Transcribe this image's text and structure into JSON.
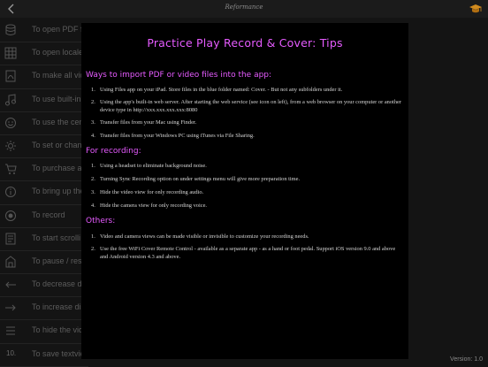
{
  "window": {
    "logo_text": "Reformance",
    "version": "Version: 1.0"
  },
  "icons": {
    "back": "back-arrow-icon",
    "top_right": "graduation-cap-icon"
  },
  "colors": {
    "accent": "#e65bff",
    "panel_bg": "#000000",
    "app_bg": "#141414"
  },
  "sidebar": {
    "items": [
      {
        "icon": "database-icon",
        "label": "To open PDF fil"
      },
      {
        "icon": "grid-icon",
        "label": "To open locale"
      },
      {
        "icon": "pdf-file-icon",
        "label": "To make all vid"
      },
      {
        "icon": "music-note-icon",
        "label": "To use built-in"
      },
      {
        "icon": "smiley-icon",
        "label": "To use the cent"
      },
      {
        "icon": "gear-icon",
        "label": "To set or chang"
      },
      {
        "icon": "cart-icon",
        "label": "To purchase an"
      },
      {
        "icon": "info-icon",
        "label": "To bring up the"
      },
      {
        "icon": "record-icon",
        "label": "To record"
      },
      {
        "icon": "document-icon",
        "label": "To start scrolli"
      },
      {
        "icon": "building-icon",
        "label": "To pause / rest"
      },
      {
        "icon": "left-arrow-icon",
        "label": "To decrease dis"
      },
      {
        "icon": "right-arrow-icon",
        "label": "To increase dis"
      },
      {
        "icon": "list-icon",
        "label": "To hide the vid"
      },
      {
        "icon": "number-icon",
        "label": "To save textvie",
        "num": "10."
      }
    ]
  },
  "panel": {
    "title": "Practice Play Record & Cover:  Tips",
    "sections": [
      {
        "heading": "Ways to import PDF or video files into the app:",
        "items": [
          {
            "n": "1.",
            "text": "Using Files app on your iPad.  Store files in the blue folder named:  Cover. - But not any subfolders under it."
          },
          {
            "n": "2.",
            "text": "Using the app's built-in web server.   After starting the web service (see icon on left), from a web browser on your computer or another device type in http://xxx.xxx.xxx.xxx:8080"
          },
          {
            "n": "3.",
            "text": "Transfer files from your Mac using Finder."
          },
          {
            "n": "4.",
            "text": "Transfer files from your Windows PC using iTunes via File Sharing."
          }
        ]
      },
      {
        "heading": "For recording:",
        "items": [
          {
            "n": "1.",
            "text": "Using a headset to eliminate background noise."
          },
          {
            "n": "2.",
            "text": "Turning Sync Recording option on under settings menu will give more preparation time."
          },
          {
            "n": "3.",
            "text": "Hide the video view for only recording audio."
          },
          {
            "n": "4.",
            "text": "Hide the camera view for only recording voice."
          }
        ]
      },
      {
        "heading": "Others:",
        "items": [
          {
            "n": "1.",
            "text": "Video and camera views can be made visible or invisible to customize your recording needs."
          },
          {
            "n": "2.",
            "text": "Use the free WiFi Cover Remote Control - available as a separate app - as a hand or foot pedal. Support iOS version 9.0 and above and Android version 4.3 and above."
          }
        ]
      }
    ]
  }
}
